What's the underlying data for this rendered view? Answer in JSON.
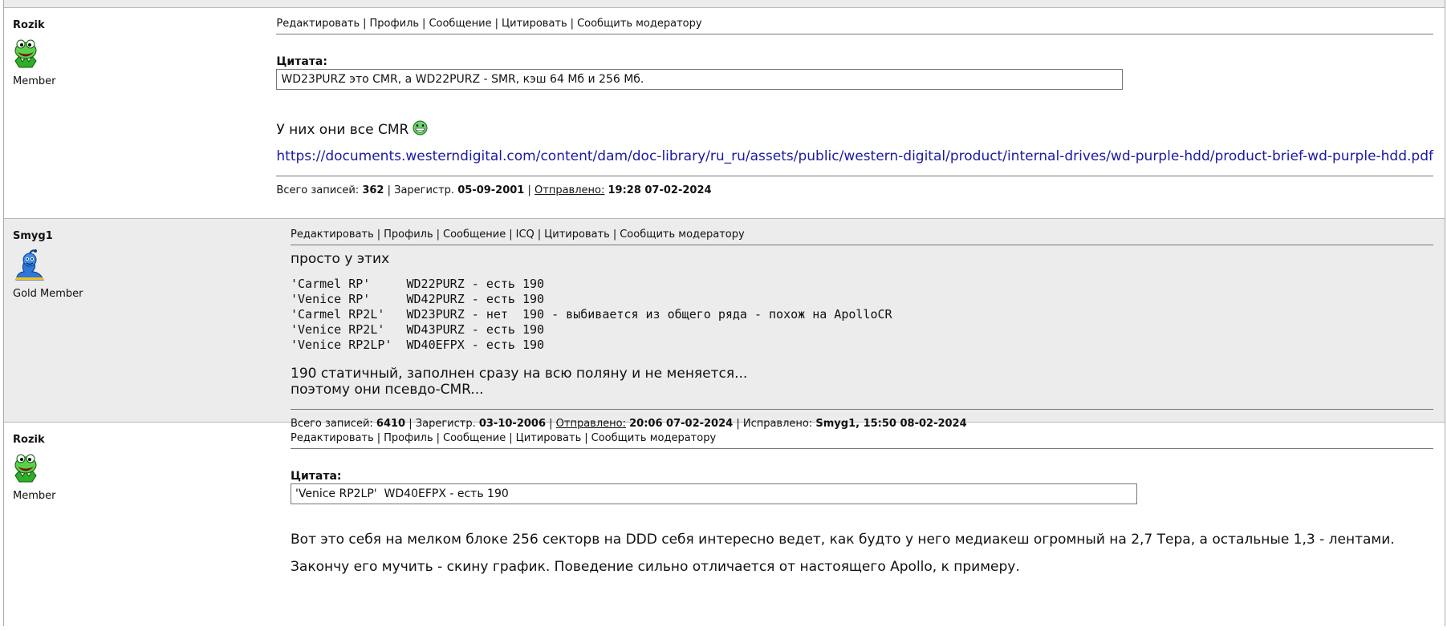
{
  "posts": [
    {
      "user": "Rozik",
      "avatar": "kermit-frog-avatar",
      "rank": "Member",
      "actions": [
        "Редактировать",
        "Профиль",
        "Сообщение",
        "Цитировать",
        "Сообщить модератору"
      ],
      "quote_label": "Цитата:",
      "quote_text": "WD23PURZ это CMR, а WD22PURZ - SMR, кэш 64 Мб и 256 Мб.",
      "text1": "У них они все CMR",
      "link": "https://documents.westerndigital.com/content/dam/doc-library/ru_ru/assets/public/western-digital/product/internal-drives/wd-purple-hdd/product-brief-wd-purple-hdd.pdf",
      "footer": {
        "posts_label": "Всего записей:",
        "posts": "362",
        "reg_label": "Зарегистр.",
        "reg": "05-09-2001",
        "sent_label": "Отправлено:",
        "sent": "19:28 07-02-2024"
      }
    },
    {
      "user": "Smyg1",
      "avatar": "genie-avatar",
      "rank": "Gold Member",
      "actions": [
        "Редактировать",
        "Профиль",
        "Сообщение",
        "ICQ",
        "Цитировать",
        "Сообщить модератору"
      ],
      "text1": "просто у этих",
      "code": "'Carmel RP'     WD22PURZ - есть 190\n'Venice RP'     WD42PURZ - есть 190\n'Carmel RP2L'   WD23PURZ - нет  190 - выбивается из общего ряда - похож на ApolloCR\n'Venice RP2L'   WD43PURZ - есть 190\n'Venice RP2LP'  WD40EFPX - есть 190",
      "text2": "190 статичный, заполнен сразу на всю поляну и не меняется...",
      "text3": "поэтому они псевдо-CMR...",
      "footer": {
        "posts_label": "Всего записей:",
        "posts": "6410",
        "reg_label": "Зарегистр.",
        "reg": "03-10-2006",
        "sent_label": "Отправлено:",
        "sent": "20:06 07-02-2024",
        "edit_label": "Исправлено:",
        "edit": "Smyg1, 15:50 08-02-2024"
      }
    },
    {
      "user": "Rozik",
      "avatar": "kermit-frog-avatar",
      "rank": "Member",
      "actions": [
        "Редактировать",
        "Профиль",
        "Сообщение",
        "Цитировать",
        "Сообщить модератору"
      ],
      "quote_label": "Цитата:",
      "quote_text": "'Venice RP2LP'  WD40EFPX - есть 190",
      "text1": "Вот это себя на мелком блоке 256 секторв на DDD себя интересно ведет, как будто у него медиакеш огромный на 2,7 Тера, а остальные 1,3 - лентами.",
      "text2": "Закончу его мучить - скину график. Поведение сильно отличается от настоящего Apollo, к примеру."
    }
  ]
}
